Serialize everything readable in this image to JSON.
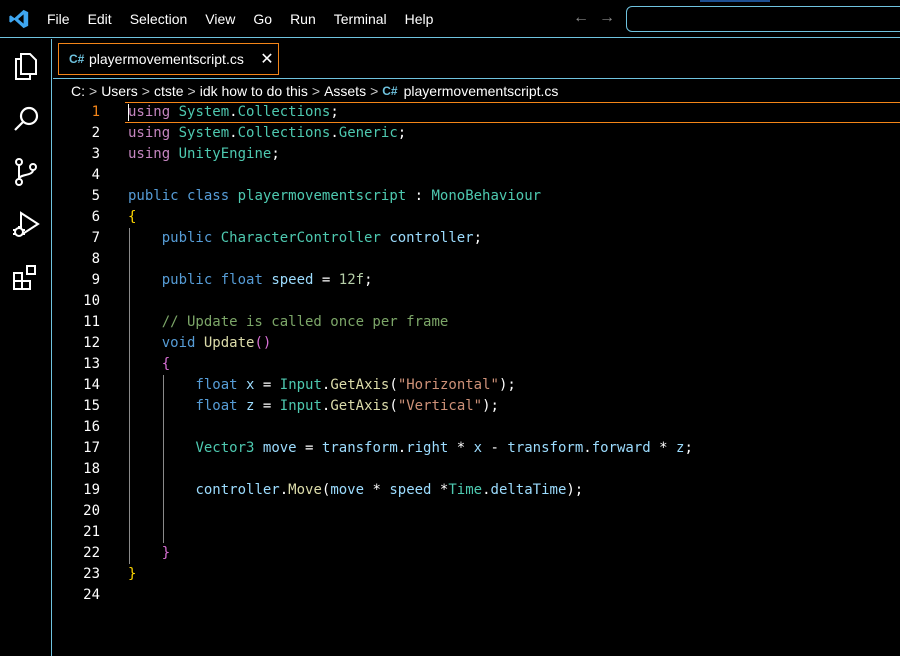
{
  "menu": [
    "File",
    "Edit",
    "Selection",
    "View",
    "Go",
    "Run",
    "Terminal",
    "Help"
  ],
  "nav": {
    "back": "←",
    "forward": "→"
  },
  "activity": [
    "explorer-icon",
    "search-icon",
    "source-control-icon",
    "run-debug-icon",
    "extensions-icon"
  ],
  "tab": {
    "icon": "C#",
    "label": "playermovementscript.cs",
    "close": "✕"
  },
  "breadcrumb": {
    "parts": [
      "C:",
      "Users",
      "ctste",
      "idk how to do this",
      "Assets"
    ],
    "sep": ">",
    "file_icon": "C#",
    "file": "playermovementscript.cs"
  },
  "editor": {
    "current_line": 1,
    "lines": [
      [
        [
          "kw",
          "using"
        ],
        [
          "pl",
          " "
        ],
        [
          "ty",
          "System"
        ],
        [
          "pl",
          "."
        ],
        [
          "ty",
          "Collections"
        ],
        [
          "pl",
          ";"
        ]
      ],
      [
        [
          "kw",
          "using"
        ],
        [
          "pl",
          " "
        ],
        [
          "ty",
          "System"
        ],
        [
          "pl",
          "."
        ],
        [
          "ty",
          "Collections"
        ],
        [
          "pl",
          "."
        ],
        [
          "ty",
          "Generic"
        ],
        [
          "pl",
          ";"
        ]
      ],
      [
        [
          "kw",
          "using"
        ],
        [
          "pl",
          " "
        ],
        [
          "ty",
          "UnityEngine"
        ],
        [
          "pl",
          ";"
        ]
      ],
      [],
      [
        [
          "kb",
          "public"
        ],
        [
          "pl",
          " "
        ],
        [
          "kb",
          "class"
        ],
        [
          "pl",
          " "
        ],
        [
          "ty",
          "playermovementscript"
        ],
        [
          "pl",
          " : "
        ],
        [
          "ty",
          "MonoBehaviour"
        ]
      ],
      [
        [
          "br1",
          "{"
        ]
      ],
      [
        [
          "pl",
          "    "
        ],
        [
          "kb",
          "public"
        ],
        [
          "pl",
          " "
        ],
        [
          "ty",
          "CharacterController"
        ],
        [
          "pl",
          " "
        ],
        [
          "va",
          "controller"
        ],
        [
          "pl",
          ";"
        ]
      ],
      [],
      [
        [
          "pl",
          "    "
        ],
        [
          "kb",
          "public"
        ],
        [
          "pl",
          " "
        ],
        [
          "kb",
          "float"
        ],
        [
          "pl",
          " "
        ],
        [
          "va",
          "speed"
        ],
        [
          "pl",
          " = "
        ],
        [
          "nm",
          "12f"
        ],
        [
          "pl",
          ";"
        ]
      ],
      [],
      [
        [
          "pl",
          "    "
        ],
        [
          "cm",
          "// Update is called once per frame"
        ]
      ],
      [
        [
          "pl",
          "    "
        ],
        [
          "kb",
          "void"
        ],
        [
          "pl",
          " "
        ],
        [
          "fn",
          "Update"
        ],
        [
          "br2",
          "()"
        ]
      ],
      [
        [
          "pl",
          "    "
        ],
        [
          "br2",
          "{"
        ]
      ],
      [
        [
          "pl",
          "        "
        ],
        [
          "kb",
          "float"
        ],
        [
          "pl",
          " "
        ],
        [
          "va",
          "x"
        ],
        [
          "pl",
          " = "
        ],
        [
          "ty",
          "Input"
        ],
        [
          "pl",
          "."
        ],
        [
          "fn",
          "GetAxis"
        ],
        [
          "pl",
          "("
        ],
        [
          "st",
          "\"Horizontal\""
        ],
        [
          "pl",
          ");"
        ]
      ],
      [
        [
          "pl",
          "        "
        ],
        [
          "kb",
          "float"
        ],
        [
          "pl",
          " "
        ],
        [
          "va",
          "z"
        ],
        [
          "pl",
          " = "
        ],
        [
          "ty",
          "Input"
        ],
        [
          "pl",
          "."
        ],
        [
          "fn",
          "GetAxis"
        ],
        [
          "pl",
          "("
        ],
        [
          "st",
          "\"Vertical\""
        ],
        [
          "pl",
          ");"
        ]
      ],
      [],
      [
        [
          "pl",
          "        "
        ],
        [
          "ty",
          "Vector3"
        ],
        [
          "pl",
          " "
        ],
        [
          "va",
          "move"
        ],
        [
          "pl",
          " = "
        ],
        [
          "va",
          "transform"
        ],
        [
          "pl",
          "."
        ],
        [
          "va",
          "right"
        ],
        [
          "pl",
          " * "
        ],
        [
          "va",
          "x"
        ],
        [
          "pl",
          " - "
        ],
        [
          "va",
          "transform"
        ],
        [
          "pl",
          "."
        ],
        [
          "va",
          "forward"
        ],
        [
          "pl",
          " * "
        ],
        [
          "va",
          "z"
        ],
        [
          "pl",
          ";"
        ]
      ],
      [],
      [
        [
          "pl",
          "        "
        ],
        [
          "va",
          "controller"
        ],
        [
          "pl",
          "."
        ],
        [
          "fn",
          "Move"
        ],
        [
          "pl",
          "("
        ],
        [
          "va",
          "move"
        ],
        [
          "pl",
          " * "
        ],
        [
          "va",
          "speed"
        ],
        [
          "pl",
          " *"
        ],
        [
          "ty",
          "Time"
        ],
        [
          "pl",
          "."
        ],
        [
          "va",
          "deltaTime"
        ],
        [
          "pl",
          ");"
        ]
      ],
      [],
      [],
      [
        [
          "pl",
          "    "
        ],
        [
          "br2",
          "}"
        ]
      ],
      [
        [
          "br1",
          "}"
        ]
      ],
      []
    ]
  },
  "colors": {
    "accent_border": "#6fc3df",
    "active_border": "#f38518",
    "background": "#000000"
  }
}
